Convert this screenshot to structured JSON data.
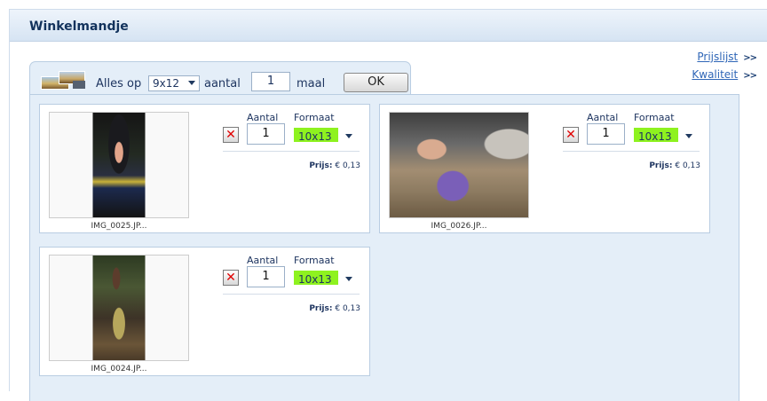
{
  "panel": {
    "title": "Winkelmandje"
  },
  "side_links": [
    {
      "label": "Prijslijst",
      "arrow": ">>"
    },
    {
      "label": "Kwaliteit",
      "arrow": ">>"
    }
  ],
  "bulk": {
    "prefix": "Alles op",
    "format_value": "9x12",
    "aantal_label": "aantal",
    "quantity": "1",
    "suffix": "maal",
    "ok_label": "OK"
  },
  "labels": {
    "aantal": "Aantal",
    "formaat": "Formaat",
    "prijs": "Prijs:"
  },
  "items": [
    {
      "filename": "IMG_0025.JP...",
      "quantity": "1",
      "format": "10x13",
      "price": "€ 0,13"
    },
    {
      "filename": "IMG_0026.JP...",
      "quantity": "1",
      "format": "10x13",
      "price": "€ 0,13"
    },
    {
      "filename": "IMG_0024.JP...",
      "quantity": "1",
      "format": "10x13",
      "price": "€ 0,13"
    }
  ],
  "colors": {
    "title": "#12325c",
    "link": "#2f66b7",
    "format_highlight": "#8ef21f",
    "delete_x": "#e00000"
  }
}
